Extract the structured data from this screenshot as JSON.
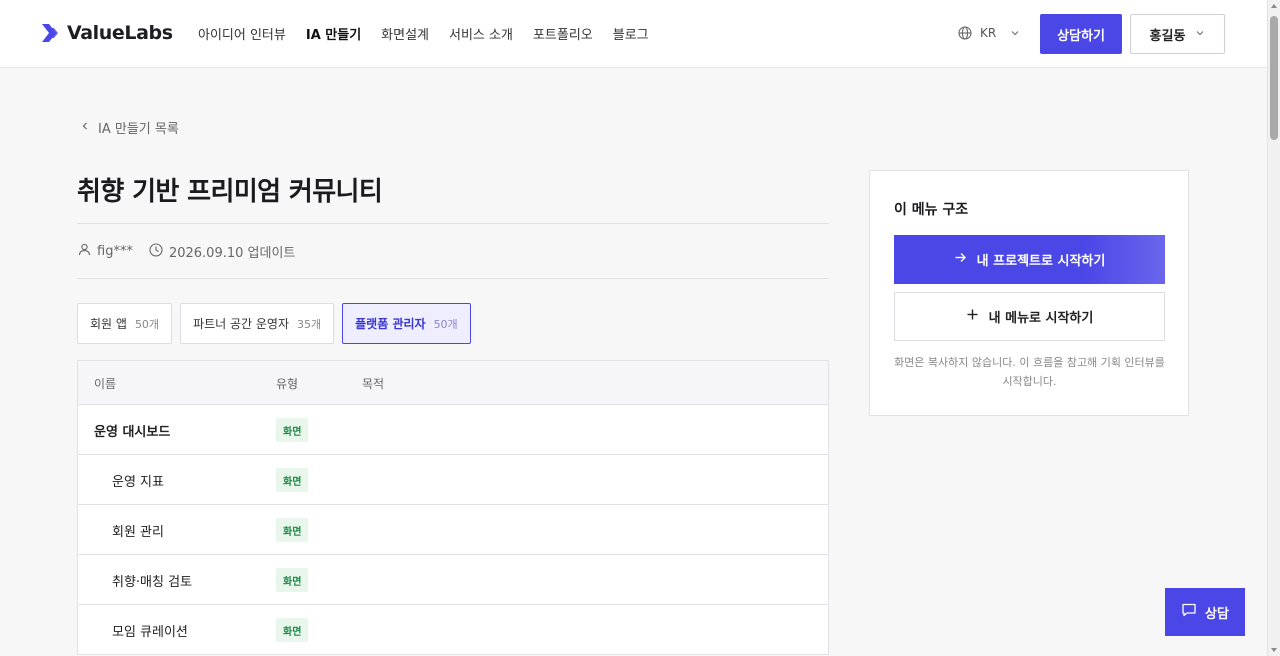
{
  "header": {
    "logo_text": "ValueLabs",
    "nav": [
      {
        "label": "아이디어 인터뷰",
        "active": false
      },
      {
        "label": "IA 만들기",
        "active": true
      },
      {
        "label": "화면설계",
        "active": false
      },
      {
        "label": "서비스 소개",
        "active": false
      },
      {
        "label": "포트폴리오",
        "active": false
      },
      {
        "label": "블로그",
        "active": false
      }
    ],
    "lang": "KR",
    "consult_label": "상담하기",
    "user_name": "홍길동"
  },
  "breadcrumb": {
    "back_label": "IA 만들기 목록"
  },
  "page": {
    "title": "취향 기반 프리미엄 커뮤니티",
    "author": "fig***",
    "updated": "2026.09.10 업데이트"
  },
  "tabs": [
    {
      "label": "회원 앱",
      "count": "50개",
      "active": false
    },
    {
      "label": "파트너 공간 운영자",
      "count": "35개",
      "active": false
    },
    {
      "label": "플랫폼 관리자",
      "count": "50개",
      "active": true
    }
  ],
  "table": {
    "headers": {
      "name": "이름",
      "type": "유형",
      "purpose": "목적"
    },
    "rows": [
      {
        "name": "운영 대시보드",
        "type": "화면",
        "child": false
      },
      {
        "name": "운영 지표",
        "type": "화면",
        "child": true
      },
      {
        "name": "회원 관리",
        "type": "화면",
        "child": true
      },
      {
        "name": "취향·매칭 검토",
        "type": "화면",
        "child": true
      },
      {
        "name": "모임 큐레이션",
        "type": "화면",
        "child": true
      }
    ]
  },
  "panel": {
    "title": "이 메뉴 구조",
    "primary_label": "내 프로젝트로 시작하기",
    "secondary_label": "내 메뉴로 시작하기",
    "note": "화면은 복사하지 않습니다. 이 흐름을 참고해 기획 인터뷰를 시작합니다."
  },
  "fab": {
    "label": "상담"
  },
  "colors": {
    "accent": "#4b46e6",
    "badge_bg": "#e8f6ec",
    "badge_text": "#1f8a45"
  }
}
